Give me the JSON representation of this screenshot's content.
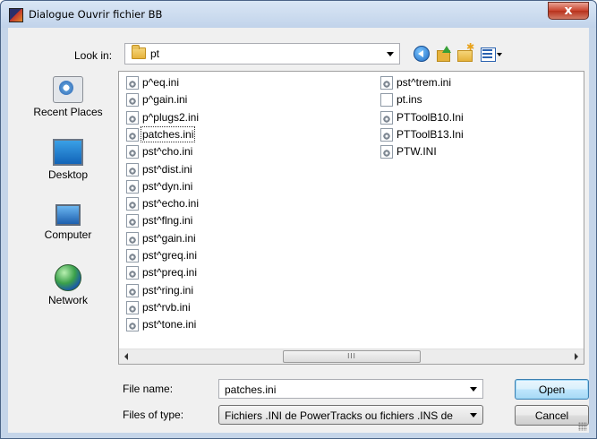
{
  "window": {
    "title": "Dialogue Ouvrir fichier BB",
    "close_label": "x"
  },
  "lookin": {
    "label": "Look in:",
    "value": "pt"
  },
  "toolbar": {
    "icons": [
      "back-icon",
      "up-folder-icon",
      "new-folder-icon",
      "views-menu-icon"
    ]
  },
  "places": [
    {
      "label": "Recent Places",
      "icon": "recent-places-icon"
    },
    {
      "label": "Desktop",
      "icon": "desktop-icon"
    },
    {
      "label": "Computer",
      "icon": "computer-icon"
    },
    {
      "label": "Network",
      "icon": "network-icon"
    }
  ],
  "files": {
    "column1": [
      "p^eq.ini",
      "p^gain.ini",
      "p^plugs2.ini",
      "patches.ini",
      "pst^cho.ini",
      "pst^dist.ini",
      "pst^dyn.ini",
      "pst^echo.ini",
      "pst^flng.ini",
      "pst^gain.ini",
      "pst^greq.ini",
      "pst^preq.ini",
      "pst^ring.ini",
      "pst^rvb.ini",
      "pst^tone.ini"
    ],
    "column2": [
      "pst^trem.ini",
      "pt.ins",
      "PTToolB10.Ini",
      "PTToolB13.Ini",
      "PTW.INI"
    ],
    "selected": "patches.ini"
  },
  "scrollbar": {
    "thumb_grip": "III"
  },
  "bottom": {
    "file_name_label": "File name:",
    "file_name_value": "patches.ini",
    "file_type_label": "Files of type:",
    "file_type_value": "Fichiers .INI de PowerTracks ou fichiers .INS de",
    "open_label": "Open",
    "cancel_label": "Cancel"
  }
}
